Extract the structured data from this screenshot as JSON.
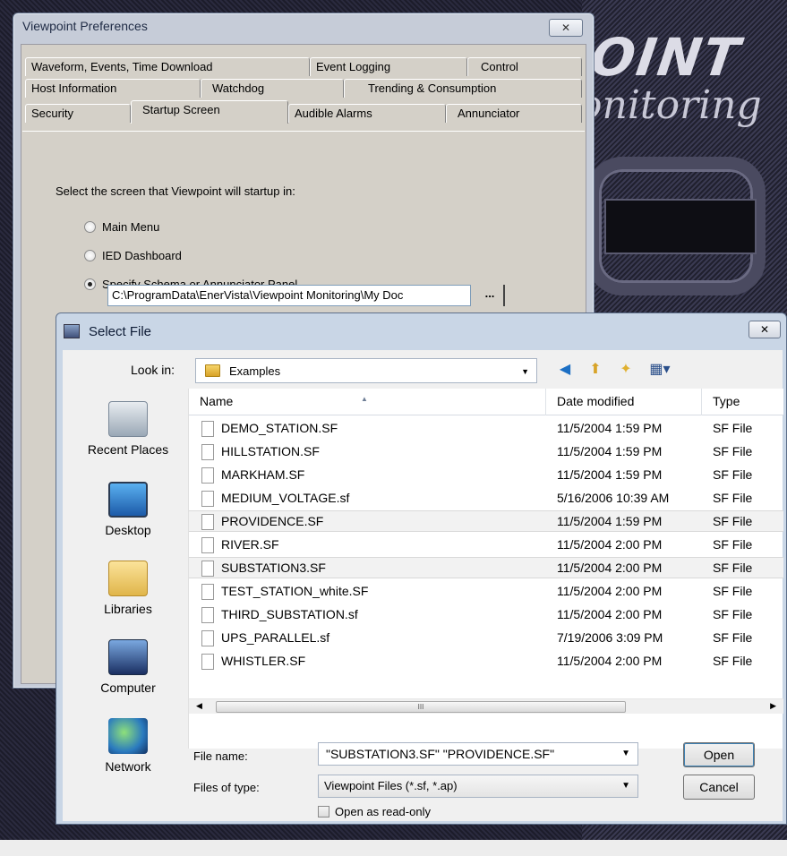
{
  "background_app": {
    "logo_top": "OINT",
    "logo_bottom": "onitoring"
  },
  "prefs": {
    "title": "Viewpoint Preferences",
    "close_glyph": "✕",
    "tabs_row1": [
      "Waveform, Events, Time Download",
      "Event Logging",
      "Control"
    ],
    "tabs_row2": [
      "Host Information",
      "Watchdog",
      "Trending & Consumption"
    ],
    "tabs_row3": [
      "Security",
      "Startup Screen",
      "Audible Alarms",
      "Annunciator"
    ],
    "prompt": "Select the screen that Viewpoint will startup in:",
    "options": [
      "Main Menu",
      "IED Dashboard",
      "Specify Schema or Annunciator Panel"
    ],
    "selected_option": "Specify Schema or Annunciator Panel",
    "path": "C:\\ProgramData\\EnerVista\\Viewpoint Monitoring\\My Doc",
    "browse_label": "..."
  },
  "dialog": {
    "title": "Select File",
    "close_glyph": "✕",
    "look_in_label": "Look in:",
    "look_in_value": "Examples",
    "toolbar_icons": [
      "back-icon",
      "up-folder-icon",
      "new-folder-icon",
      "view-menu-icon"
    ],
    "places": [
      "Recent Places",
      "Desktop",
      "Libraries",
      "Computer",
      "Network"
    ],
    "columns": [
      "Name",
      "Date modified",
      "Type"
    ],
    "files": [
      {
        "name": "DEMO_STATION.SF",
        "date": "11/5/2004 1:59 PM",
        "type": "SF File"
      },
      {
        "name": "HILLSTATION.SF",
        "date": "11/5/2004 1:59 PM",
        "type": "SF File"
      },
      {
        "name": "MARKHAM.SF",
        "date": "11/5/2004 1:59 PM",
        "type": "SF File"
      },
      {
        "name": "MEDIUM_VOLTAGE.sf",
        "date": "5/16/2006 10:39 AM",
        "type": "SF File"
      },
      {
        "name": "PROVIDENCE.SF",
        "date": "11/5/2004 1:59 PM",
        "type": "SF File"
      },
      {
        "name": "RIVER.SF",
        "date": "11/5/2004 2:00 PM",
        "type": "SF File"
      },
      {
        "name": "SUBSTATION3.SF",
        "date": "11/5/2004 2:00 PM",
        "type": "SF File"
      },
      {
        "name": "TEST_STATION_white.SF",
        "date": "11/5/2004 2:00 PM",
        "type": "SF File"
      },
      {
        "name": "THIRD_SUBSTATION.sf",
        "date": "11/5/2004 2:00 PM",
        "type": "SF File"
      },
      {
        "name": "UPS_PARALLEL.sf",
        "date": "7/19/2006 3:09 PM",
        "type": "SF File"
      },
      {
        "name": "WHISTLER.SF",
        "date": "11/5/2004 2:00 PM",
        "type": "SF File"
      }
    ],
    "selected_files": [
      "PROVIDENCE.SF",
      "SUBSTATION3.SF"
    ],
    "file_name_label": "File name:",
    "file_name_value": "\"SUBSTATION3.SF\" \"PROVIDENCE.SF\"",
    "files_of_type_label": "Files of type:",
    "files_of_type_value": "Viewpoint Files (*.sf, *.ap)",
    "read_only_label": "Open as read-only",
    "open_label": "Open",
    "cancel_label": "Cancel",
    "scroll_grip": "III"
  }
}
